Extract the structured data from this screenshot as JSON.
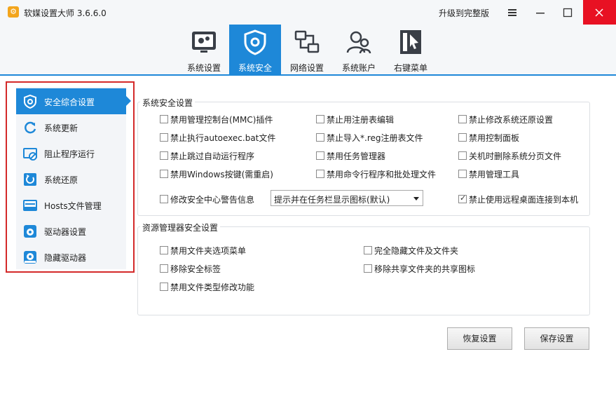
{
  "window": {
    "title": "软媒设置大师 3.6.6.0",
    "upgrade_label": "升级到完整版"
  },
  "tabs": [
    {
      "label": "系统设置",
      "icon": "gear-monitor-icon"
    },
    {
      "label": "系统安全",
      "icon": "shield-icon",
      "active": true
    },
    {
      "label": "网络设置",
      "icon": "network-icon"
    },
    {
      "label": "系统账户",
      "icon": "users-icon"
    },
    {
      "label": "右键菜单",
      "icon": "cursor-menu-icon"
    }
  ],
  "sidebar": {
    "items": [
      {
        "label": "安全综合设置",
        "icon": "shield-icon",
        "active": true
      },
      {
        "label": "系统更新",
        "icon": "refresh-icon"
      },
      {
        "label": "阻止程序运行",
        "icon": "block-window-icon"
      },
      {
        "label": "系统还原",
        "icon": "restore-icon"
      },
      {
        "label": "Hosts文件管理",
        "icon": "hosts-icon"
      },
      {
        "label": "驱动器设置",
        "icon": "disk-icon"
      },
      {
        "label": "隐藏驱动器",
        "icon": "hide-disk-icon"
      }
    ]
  },
  "system_security": {
    "title": "系统安全设置",
    "options": [
      {
        "label": "禁用管理控制台(MMC)插件",
        "checked": false
      },
      {
        "label": "禁止用注册表编辑",
        "checked": false
      },
      {
        "label": "禁止修改系统还原设置",
        "checked": false
      },
      {
        "label": "禁止执行autoexec.bat文件",
        "checked": false
      },
      {
        "label": "禁止导入*.reg注册表文件",
        "checked": false
      },
      {
        "label": "禁用控制面板",
        "checked": false
      },
      {
        "label": "禁止跳过自动运行程序",
        "checked": false
      },
      {
        "label": "禁用任务管理器",
        "checked": false
      },
      {
        "label": "关机时删除系统分页文件",
        "checked": false
      },
      {
        "label": "禁用Windows按键(需重启)",
        "checked": false
      },
      {
        "label": "禁用命令行程序和批处理文件",
        "checked": false
      },
      {
        "label": "禁用管理工具",
        "checked": false
      }
    ],
    "warning_option": {
      "label": "修改安全中心警告信息",
      "checked": false
    },
    "warning_select_value": "提示并在任务栏显示图标(默认)",
    "remote_option": {
      "label": "禁止使用远程桌面连接到本机",
      "checked": true
    }
  },
  "explorer_security": {
    "title": "资源管理器安全设置",
    "options": [
      {
        "label": "禁用文件夹选项菜单",
        "checked": false
      },
      {
        "label": "完全隐藏文件及文件夹",
        "checked": false
      },
      {
        "label": "移除安全标签",
        "checked": false
      },
      {
        "label": "移除共享文件夹的共享图标",
        "checked": false
      },
      {
        "label": "禁用文件类型修改功能",
        "checked": false
      }
    ]
  },
  "buttons": {
    "restore": "恢复设置",
    "save": "保存设置"
  },
  "colors": {
    "accent": "#1e88d8",
    "highlight_border": "#d42a2a",
    "close_button": "#e81123"
  }
}
